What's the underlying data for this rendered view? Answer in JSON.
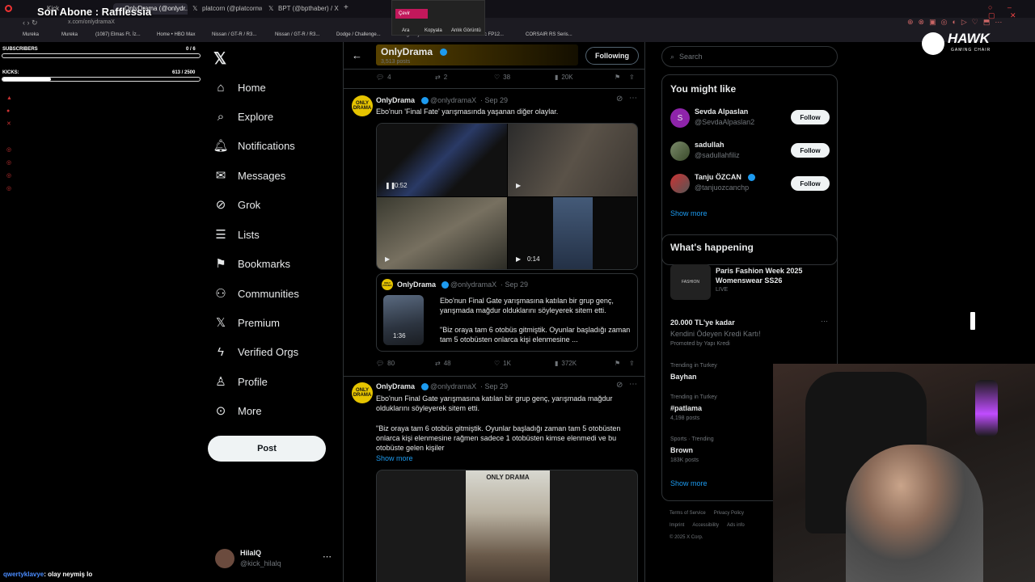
{
  "browser": {
    "tabs": [
      "Kick",
      "OnlyDrama (@onlydr...",
      "platcorn (@platcornweb)",
      "BPT (@bpthaber) / X"
    ],
    "url": "x.com/onlydramaX",
    "bookmarks": [
      "Mureka",
      "Mureka",
      "(1087) Elmas Ft. İz...",
      "Home • HBO Max",
      "Nissan / GT-R / R3...",
      "Nissan / GT-R / R3...",
      "Dodge / Challenge...",
      "Eligibility and...",
      "HYTE Thicc FP12...",
      "CORSAIR RS Seris..."
    ],
    "context_menu": {
      "translate": "Çevir",
      "search": "Ara",
      "copy": "Kopyala",
      "screenshot": "Anlık Görüntü"
    }
  },
  "stream_overlay": {
    "title": "Son Abone : Rafflessia",
    "subscribers_label": "SUBSCRIBERS",
    "subscribers_value": "0 / 6",
    "subscribers_progress": 0,
    "kicks_label": "KICKS:",
    "kicks_value": "613 / 2500",
    "kicks_progress": 0.245,
    "chat_user": "qwertyklavye",
    "chat_message": ": olay neymiş lo",
    "sponsor_logo": "HAWK",
    "sponsor_sub": "GAMING CHAIR"
  },
  "sidebar": {
    "items": [
      {
        "label": "Home",
        "icon": "home-icon"
      },
      {
        "label": "Explore",
        "icon": "search-icon"
      },
      {
        "label": "Notifications",
        "icon": "bell-icon"
      },
      {
        "label": "Messages",
        "icon": "mail-icon"
      },
      {
        "label": "Grok",
        "icon": "grok-icon"
      },
      {
        "label": "Lists",
        "icon": "list-icon"
      },
      {
        "label": "Bookmarks",
        "icon": "bookmark-icon"
      },
      {
        "label": "Communities",
        "icon": "people-icon"
      },
      {
        "label": "Premium",
        "icon": "x-logo-icon"
      },
      {
        "label": "Verified Orgs",
        "icon": "lightning-icon"
      },
      {
        "label": "Profile",
        "icon": "person-icon"
      },
      {
        "label": "More",
        "icon": "more-circle-icon"
      }
    ],
    "post_label": "Post",
    "account_name": "HilalQ",
    "account_handle": "@kick_hilalq"
  },
  "profile_header": {
    "name": "OnlyDrama",
    "posts": "3,513 posts",
    "following_label": "Following"
  },
  "top_actions": {
    "replies": "4",
    "reposts": "2",
    "likes": "38",
    "views": "20K"
  },
  "tweets": [
    {
      "name": "OnlyDrama",
      "handle": "@onlydramaX",
      "date": "· Sep 29",
      "text": "Ebo'nun 'Final Fate' yarışmasında yaşanan diğer olaylar.",
      "video1_time": "0:52",
      "video2_time": "0:14",
      "quote": {
        "name": "OnlyDrama",
        "handle": "@onlydramaX",
        "date": "· Sep 29",
        "thumb_time": "1:36",
        "text1": "Ebo'nun Final Gate yarışmasına katılan bir grup genç, yarışmada mağdur olduklarını söyleyerek sitem etti.",
        "text2": "\"Biz oraya tam 6 otobüs gitmiştik. Oyunlar başladığı zaman tam 5 otobüsten onlarca kişi elenmesine ..."
      },
      "replies": "80",
      "reposts": "48",
      "likes": "1K",
      "views": "372K"
    },
    {
      "name": "OnlyDrama",
      "handle": "@onlydramaX",
      "date": "· Sep 29",
      "text1": "Ebo'nun Final Gate yarışmasına katılan bir grup genç, yarışmada mağdur olduklarını söyleyerek sitem etti.",
      "text2": "\"Biz oraya tam 6 otobüs gitmiştik. Oyunlar başladığı zaman tam 5 otobüsten onlarca kişi elenmesine rağmen sadece 1 otobüsten kimse elenmedi ve bu otobüste gelen kişiler",
      "show_more": "Show more",
      "media_logo": "ONLY DRAMA"
    }
  ],
  "search": {
    "placeholder": "Search"
  },
  "who_to_follow": {
    "title": "You might like",
    "users": [
      {
        "name": "Sevda Alpaslan",
        "handle": "@SevdaAlpaslan2",
        "initial": "S",
        "verified": false
      },
      {
        "name": "sadullah",
        "handle": "@sadullahfiliz",
        "initial": "",
        "verified": false
      },
      {
        "name": "Tanju ÖZCAN",
        "handle": "@tanjuozcanchp",
        "initial": "",
        "verified": true
      }
    ],
    "follow_label": "Follow",
    "show_more": "Show more"
  },
  "happening": {
    "title": "What's happening",
    "event_title": "Paris Fashion Week 2025 Womenswear SS26",
    "event_status": "LIVE",
    "event_thumb_label": "FASHION",
    "promo_title": "20.000 TL'ye kadar",
    "promo_sub": "Kendini Ödeyen Kredi Kartı!",
    "promo_by": "Promoted by Yapı Kredi",
    "trends": [
      {
        "context": "Trending in Turkey",
        "name": "Bayhan",
        "count": ""
      },
      {
        "context": "Trending in Turkey",
        "name": "#patlama",
        "count": "4,198 posts"
      },
      {
        "context": "Sports · Trending",
        "name": "Brown",
        "count": "183K posts"
      }
    ],
    "show_more": "Show more"
  },
  "footer": {
    "links_row1": [
      "Terms of Service",
      "Privacy Policy"
    ],
    "links_row2": [
      "Imprint",
      "Accessibility",
      "Ads info"
    ],
    "copyright": "© 2025 X Corp."
  },
  "colors": {
    "accent": "#1d9bf0",
    "bg": "#000000",
    "border": "#2f3336",
    "muted": "#71767b",
    "promo_yellow": "#e6c400"
  }
}
